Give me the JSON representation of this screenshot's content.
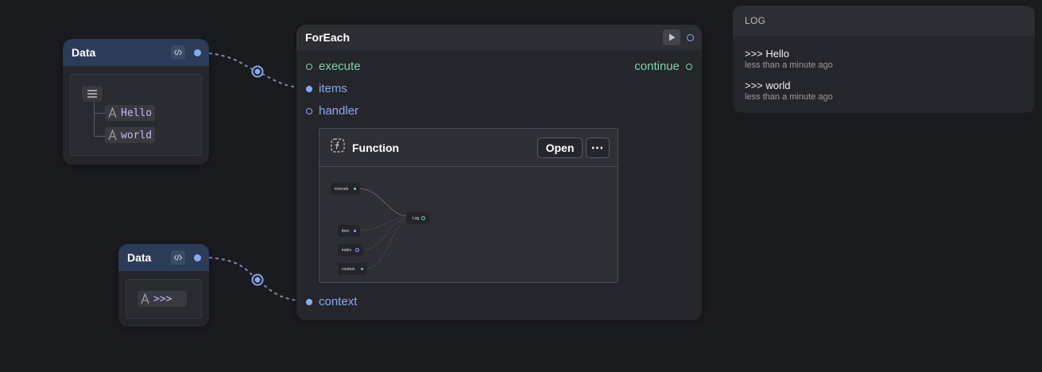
{
  "data_nodes": [
    {
      "title": "Data",
      "items": [
        "Hello",
        "world"
      ]
    },
    {
      "title": "Data",
      "value": ">>>"
    }
  ],
  "foreach": {
    "title": "ForEach",
    "ports": {
      "execute": "execute",
      "continue": "continue",
      "items": "items",
      "handler": "handler",
      "context": "context"
    },
    "function_card": {
      "title": "Function",
      "open_label": "Open",
      "more_label": "⋯",
      "preview_nodes": {
        "execute": "execute",
        "item": "item",
        "index": "index",
        "context": "context",
        "log": "Log"
      }
    }
  },
  "log": {
    "title": "LOG",
    "entries": [
      {
        "message": ">>> Hello",
        "time": "less than a minute ago"
      },
      {
        "message": ">>> world",
        "time": "less than a minute ago"
      }
    ]
  },
  "colors": {
    "background": "#1a1b1f",
    "node": "#25262b",
    "data_header": "#2c3b57",
    "accent_blue": "#8aa9ee",
    "accent_green": "#7fd1a8",
    "string_text": "#c9b6f0"
  }
}
